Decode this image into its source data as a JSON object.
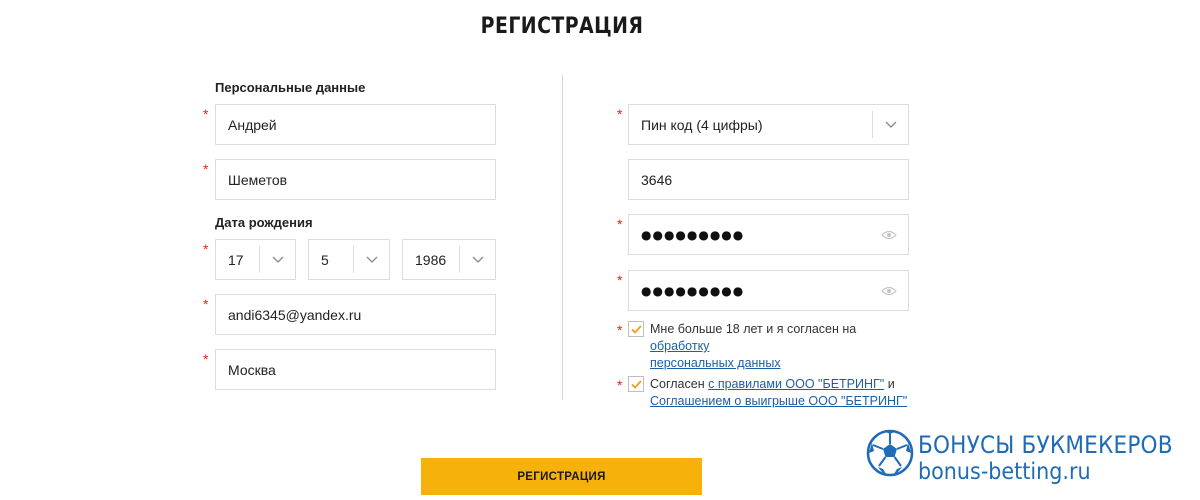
{
  "title": "РЕГИСТРАЦИЯ",
  "left": {
    "personal_label": "Персональные данные",
    "first_name": "Андрей",
    "last_name": "Шеметов",
    "birth_label": "Дата рождения",
    "birth_day": "17",
    "birth_month": "5",
    "birth_year": "1986",
    "email": "andi6345@yandex.ru",
    "city": "Москва"
  },
  "right": {
    "pin_select": "Пин код (4 цифры)",
    "pin_value": "3646",
    "password_mask": "●●●●●●●●●",
    "password_confirm_mask": "●●●●●●●●●"
  },
  "consents": {
    "age_text": "Мне больше 18 лет и я согласен на ",
    "age_link1": "обработку",
    "age_link2": "персональных данных",
    "rules_text1": "Согласен ",
    "rules_link1": "с правилами ООО \"БЕТРИНГ\"",
    "rules_text2": " и",
    "rules_link2": "Соглашением о выигрыше ООО \"БЕТРИНГ\""
  },
  "submit_label": "РЕГИСТРАЦИЯ",
  "watermark": {
    "title": "БОНУСЫ БУКМЕКЕРОВ",
    "url": "bonus-betting.ru"
  },
  "colors": {
    "accent": "#f7b10b",
    "required": "#e2231a",
    "link": "#1b5fa8",
    "check": "#f39a1e"
  }
}
